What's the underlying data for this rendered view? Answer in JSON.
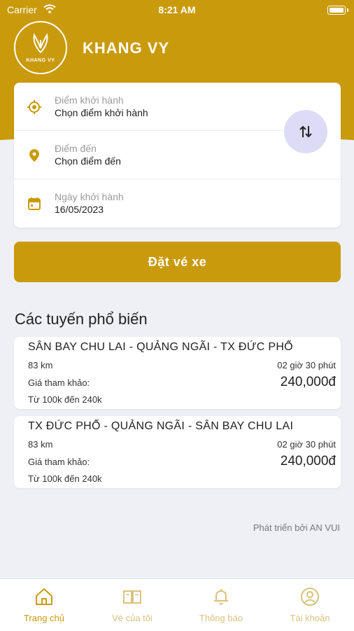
{
  "status_bar": {
    "carrier": "Carrier",
    "time": "8:21 AM"
  },
  "header": {
    "logo_text": "KHANG VY",
    "brand": "KHANG VY"
  },
  "search": {
    "departure": {
      "label": "Điểm khởi hành",
      "value": "Chọn điểm khởi hành"
    },
    "destination": {
      "label": "Điểm đến",
      "value": "Chọn điểm đến"
    },
    "date": {
      "label": "Ngày khởi hành",
      "value": "16/05/2023"
    }
  },
  "book_button": "Đặt vé xe",
  "popular": {
    "title": "Các tuyến phổ biến",
    "routes": [
      {
        "name": "SÂN BAY CHU LAI - QUẢNG NGÃI - TX ĐỨC PHỔ",
        "distance": "83 km",
        "duration": "02 giờ 30 phút",
        "ref_label": "Giá tham khảo:",
        "price": "240,000đ",
        "range": "Từ 100k đến 240k"
      },
      {
        "name": "TX ĐỨC PHỔ - QUẢNG NGÃI - SÂN BAY CHU LAI",
        "distance": "83 km",
        "duration": "02 giờ 30 phút",
        "ref_label": "Giá tham khảo:",
        "price": "240,000đ",
        "range": "Từ 100k đến 240k"
      }
    ]
  },
  "developer": "Phát triển bởi AN VUI",
  "tabs": [
    {
      "label": "Trang chủ",
      "icon": "home-icon",
      "active": true
    },
    {
      "label": "Vé của tôi",
      "icon": "ticket-book-icon",
      "active": false
    },
    {
      "label": "Thông báo",
      "icon": "bell-icon",
      "active": false
    },
    {
      "label": "Tài khoản",
      "icon": "account-icon",
      "active": false
    }
  ],
  "colors": {
    "brand": "#c99a0b",
    "swap_bg": "#dcdcf6",
    "background": "#eef0f6"
  }
}
